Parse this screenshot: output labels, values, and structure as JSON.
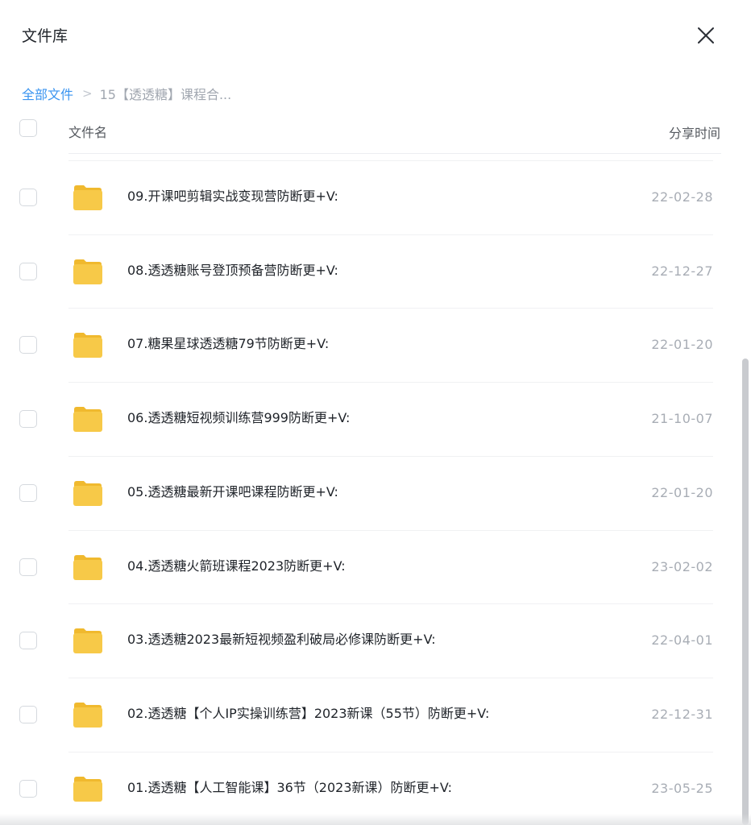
{
  "dialog": {
    "title": "文件库"
  },
  "icons": {
    "close": "close-icon",
    "folder": "folder-icon",
    "separator": "chevron-right-icon"
  },
  "colors": {
    "link": "#3a94f0",
    "folder": "#f7c948",
    "text": "#1f2329",
    "muted": "#a8adb5"
  },
  "breadcrumb": {
    "root": "全部文件",
    "separator": ">",
    "current": "15【透透糖】课程合..."
  },
  "table": {
    "columns": {
      "name": "文件名",
      "shared_time": "分享时间"
    },
    "rows": [
      {
        "name": "09.开课吧剪辑实战变现营防断更+V:",
        "date": "22-02-28"
      },
      {
        "name": "08.透透糖账号登顶预备营防断更+V:",
        "date": "22-12-27"
      },
      {
        "name": "07.糖果星球透透糖79节防断更+V:",
        "date": "22-01-20"
      },
      {
        "name": "06.透透糖短视频训练营999防断更+V:",
        "date": "21-10-07"
      },
      {
        "name": "05.透透糖最新开课吧课程防断更+V:",
        "date": "22-01-20"
      },
      {
        "name": "04.透透糖火箭班课程2023防断更+V:",
        "date": "23-02-02"
      },
      {
        "name": "03.透透糖2023最新短视频盈利破局必修课防断更+V:",
        "date": "22-04-01"
      },
      {
        "name": "02.透透糖【个人IP实操训练营】2023新课（55节）防断更+V:",
        "date": "22-12-31"
      },
      {
        "name": "01.透透糖【人工智能课】36节（2023新课）防断更+V:",
        "date": "23-05-25"
      }
    ]
  }
}
